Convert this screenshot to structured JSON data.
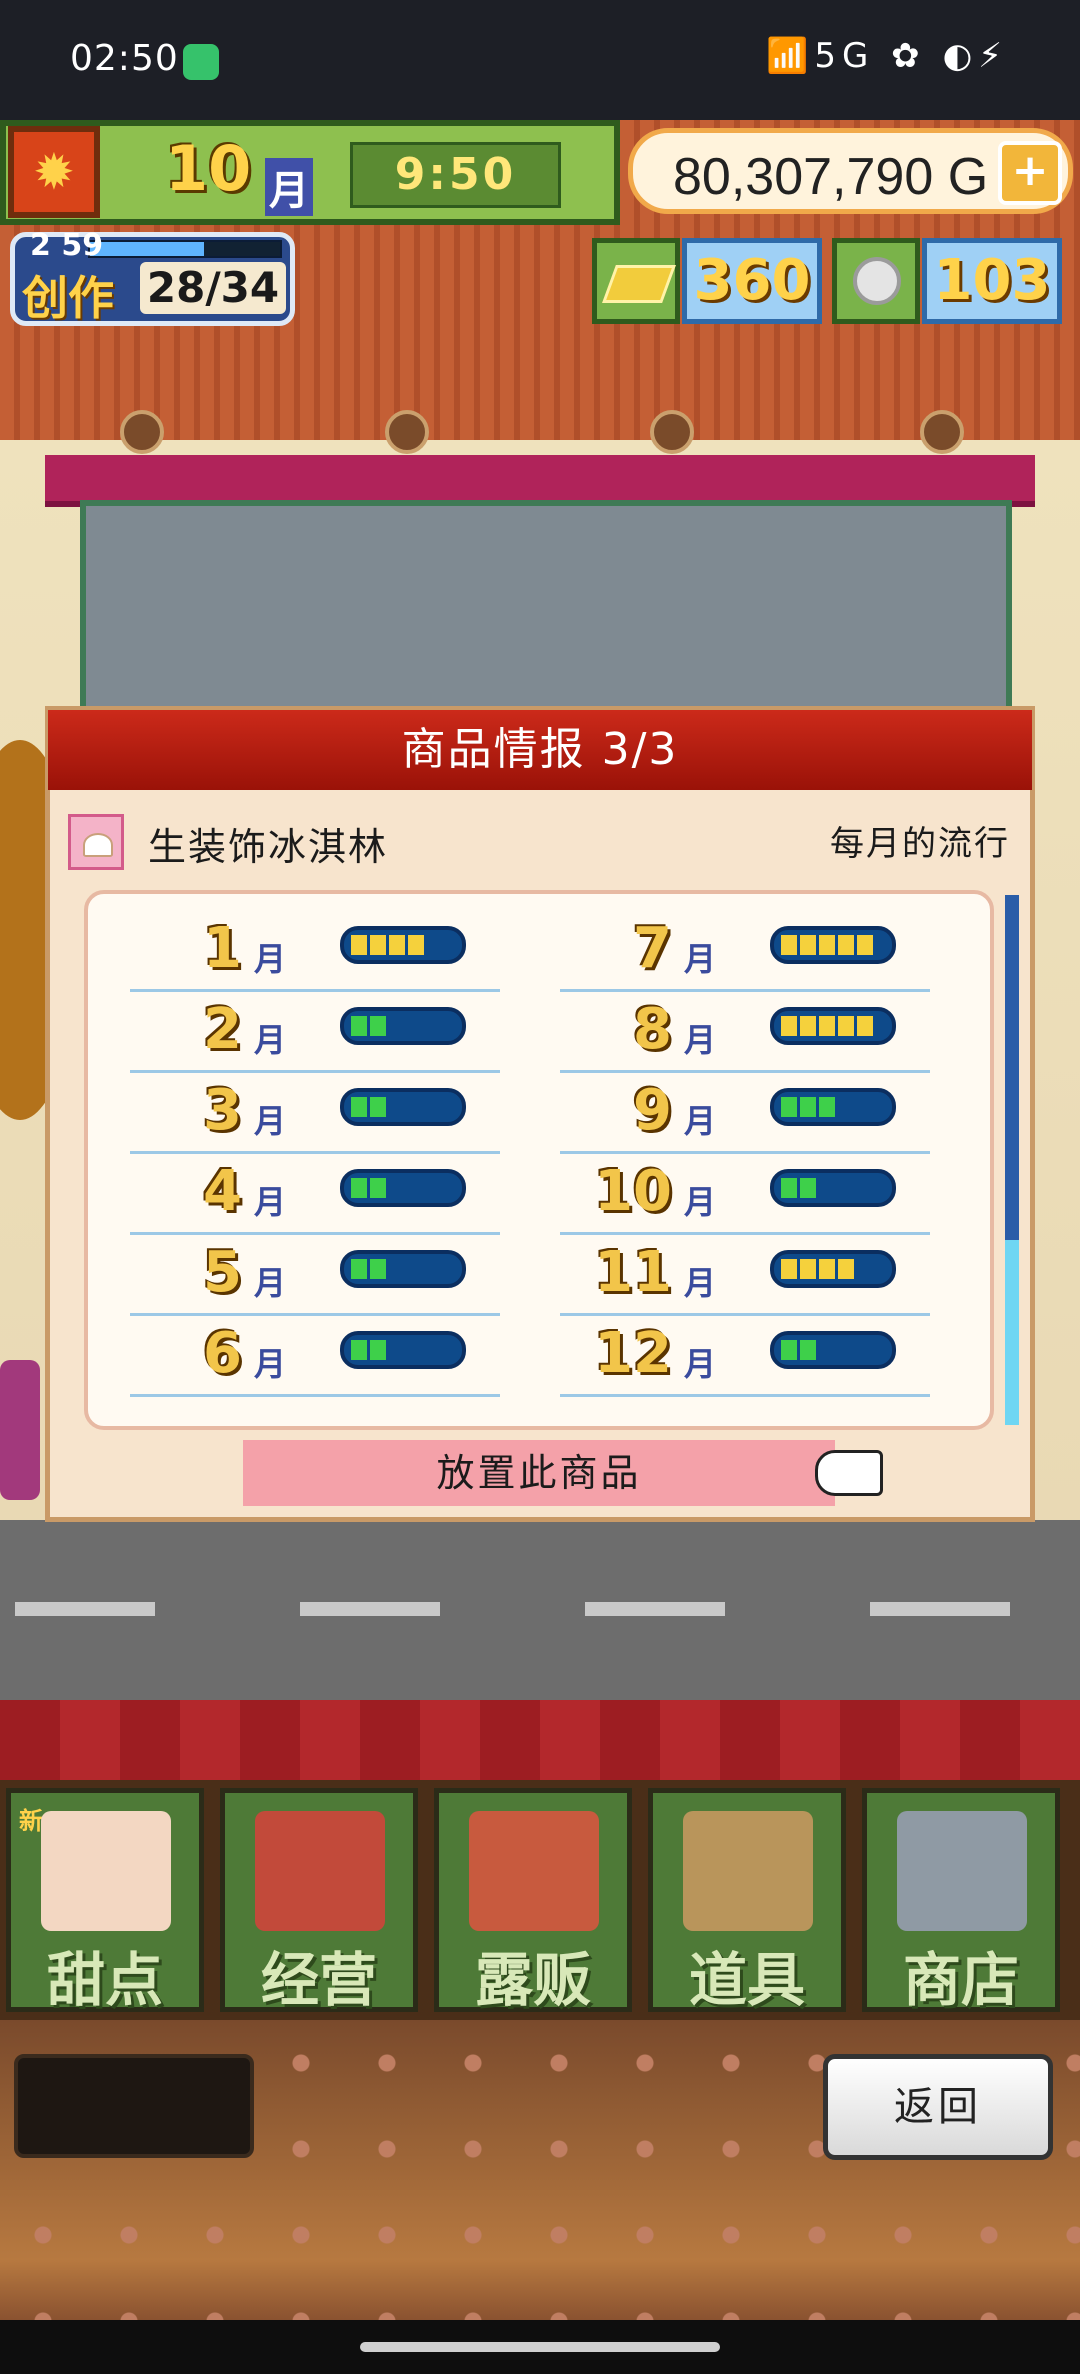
{
  "status_bar": {
    "time": "02:50",
    "icons": "📶5G ✿ ◐⚡"
  },
  "hud": {
    "month_num": "10",
    "month_unit": "月",
    "clock": "9:50",
    "money": "80,307,790 G",
    "money_plus": "+",
    "level": "2 59",
    "create_label": "创作",
    "create_count": "28/34",
    "gold_count": "360",
    "silver_count": "103"
  },
  "dialog": {
    "title": "商品情报 3/3",
    "item_name": "生装饰冰淇林",
    "trend_label": "每月的流行",
    "month_unit": "月",
    "months": [
      {
        "month": "1",
        "level": 4,
        "color": "yellow"
      },
      {
        "month": "2",
        "level": 2,
        "color": "green"
      },
      {
        "month": "3",
        "level": 2,
        "color": "green"
      },
      {
        "month": "4",
        "level": 2,
        "color": "green"
      },
      {
        "month": "5",
        "level": 2,
        "color": "green"
      },
      {
        "month": "6",
        "level": 2,
        "color": "green"
      },
      {
        "month": "7",
        "level": 5,
        "color": "yellow"
      },
      {
        "month": "8",
        "level": 5,
        "color": "yellow"
      },
      {
        "month": "9",
        "level": 3,
        "color": "green"
      },
      {
        "month": "10",
        "level": 2,
        "color": "green"
      },
      {
        "month": "11",
        "level": 4,
        "color": "yellow"
      },
      {
        "month": "12",
        "level": 2,
        "color": "green"
      }
    ],
    "place_button": "放置此商品"
  },
  "menu": {
    "new_tag": "新",
    "items": [
      {
        "label": "甜点"
      },
      {
        "label": "经营"
      },
      {
        "label": "露贩"
      },
      {
        "label": "道具"
      },
      {
        "label": "商店"
      }
    ]
  },
  "footer": {
    "back_button": "返回"
  },
  "colors": {
    "accent_red": "#cc2a1a",
    "menu_green": "#4e7a37",
    "gold": "#f2c54a"
  }
}
